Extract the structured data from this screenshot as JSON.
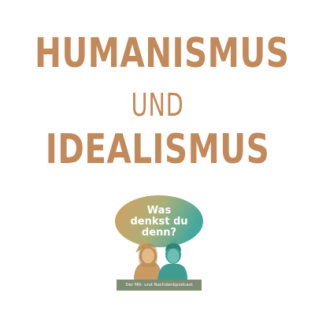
{
  "title": {
    "line1": "HUMANISMUS",
    "line2": "UND",
    "line3": "IDEALISMUS"
  },
  "logo": {
    "bubble_line1": "Was",
    "bubble_line2": "denkst du",
    "bubble_line3": "denn?",
    "tagline": "Der Mit- und Nachdenkpodcast"
  },
  "colors": {
    "title": "#c2895a",
    "bubble_gold": "#d3a463",
    "bubble_teal": "#4fa79b",
    "woman": "#c99a62",
    "man": "#3e9c90",
    "tagline_bg": "#7d8c73"
  }
}
